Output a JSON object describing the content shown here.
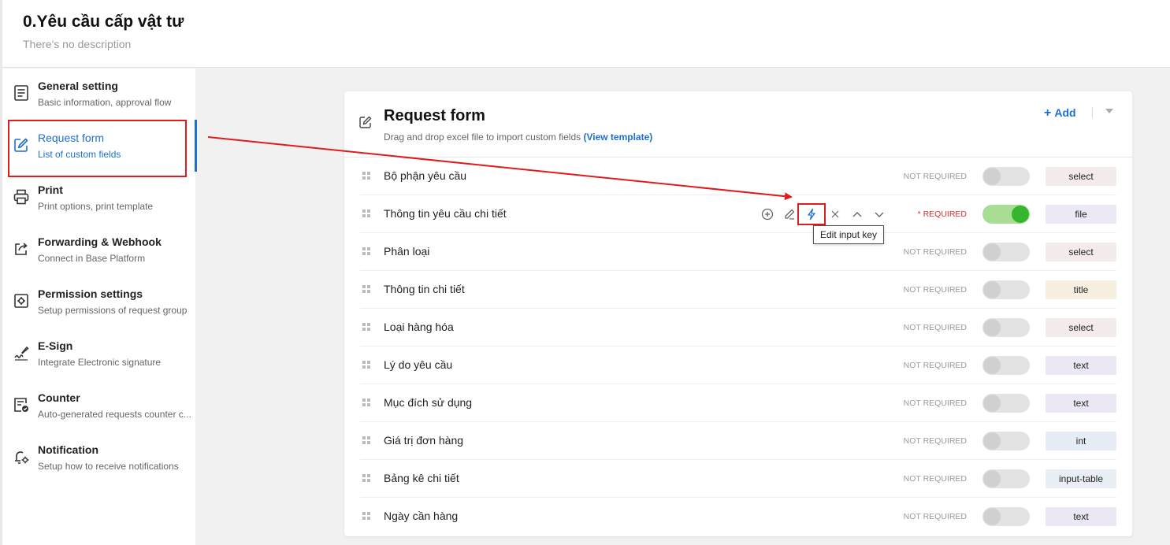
{
  "header": {
    "title": "0.Yêu cầu cấp vật tư",
    "description": "There's no description"
  },
  "sidebar": {
    "items": [
      {
        "title": "General setting",
        "subtitle": "Basic information, approval flow",
        "icon": "document-list-icon"
      },
      {
        "title": "Request form",
        "subtitle": "List of custom fields",
        "icon": "edit-square-icon",
        "active": true
      },
      {
        "title": "Print",
        "subtitle": "Print options, print template",
        "icon": "printer-icon"
      },
      {
        "title": "Forwarding & Webhook",
        "subtitle": "Connect in Base Platform",
        "icon": "share-out-icon"
      },
      {
        "title": "Permission settings",
        "subtitle": "Setup permissions of request group",
        "icon": "gear-square-icon"
      },
      {
        "title": "E-Sign",
        "subtitle": "Integrate Electronic signature",
        "icon": "signature-pen-icon"
      },
      {
        "title": "Counter",
        "subtitle": "Auto-generated requests counter c...",
        "icon": "counter-list-icon"
      },
      {
        "title": "Notification",
        "subtitle": "Setup how to receive notifications",
        "icon": "bell-gear-icon"
      }
    ]
  },
  "card": {
    "title": "Request form",
    "subtitle": "Drag and drop excel file to import custom fields",
    "template_link": "(View template)",
    "add_label": "Add"
  },
  "fields": [
    {
      "label": "Bộ phận yêu cầu",
      "required_text": "NOT REQUIRED",
      "required": false,
      "type": "select",
      "type_color": "#f3ebe9"
    },
    {
      "label": "Thông tin yêu cầu chi tiết",
      "required_text": "* REQUIRED",
      "required": true,
      "type": "file",
      "type_color": "#ece8f5"
    },
    {
      "label": "Phân loại",
      "required_text": "NOT REQUIRED",
      "required": false,
      "type": "select",
      "type_color": "#f3ebe9"
    },
    {
      "label": "Thông tin chi tiết",
      "required_text": "NOT REQUIRED",
      "required": false,
      "type": "title",
      "type_color": "#f7f0e1"
    },
    {
      "label": "Loại hàng hóa",
      "required_text": "NOT REQUIRED",
      "required": false,
      "type": "select",
      "type_color": "#f3ebe9"
    },
    {
      "label": "Lý do yêu cầu",
      "required_text": "NOT REQUIRED",
      "required": false,
      "type": "text",
      "type_color": "#ebe8f4"
    },
    {
      "label": "Mục đích sử dụng",
      "required_text": "NOT REQUIRED",
      "required": false,
      "type": "text",
      "type_color": "#ebe8f4"
    },
    {
      "label": "Giá trị đơn hàng",
      "required_text": "NOT REQUIRED",
      "required": false,
      "type": "int",
      "type_color": "#e6edf5"
    },
    {
      "label": "Bảng kê chi tiết",
      "required_text": "NOT REQUIRED",
      "required": false,
      "type": "input-table",
      "type_color": "#e9eef4"
    },
    {
      "label": "Ngày cần hàng",
      "required_text": "NOT REQUIRED",
      "required": false,
      "type": "text",
      "type_color": "#ebe8f4"
    }
  ],
  "tooltip": "Edit input key",
  "colors": {
    "accent": "#1e6fd0",
    "highlight": "#e01b1b",
    "toggle_on": "#36b52e"
  }
}
